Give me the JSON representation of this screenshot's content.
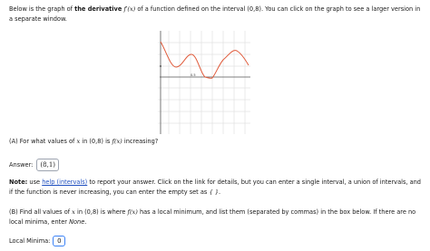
{
  "intro": {
    "p1": "Below is the graph of ",
    "bold": "the derivative",
    "fprime": "f′(x)",
    "p2": " of a function defined on the interval (0,8). You can click on the graph to see a larger version in a separate window."
  },
  "graph": {
    "axis_label": "0.5",
    "curve_color": "#e05a3a"
  },
  "question_a": {
    "p1": "(A) For what values of ",
    "x": "x",
    "p2": " in (0,8) is ",
    "fx": "f(x)",
    "p3": " increasing?"
  },
  "answer_a": {
    "label": "Answer:",
    "value": "(8,1)"
  },
  "note": {
    "bold": "Note:",
    "p1": " use ",
    "link": "help (intervals)",
    "p2": " to report your answer. Click on the link for details, but you can enter a single interval, a union of intervals, and if the function is never increasing, you can enter the empty set as ",
    "empty_set": "{ }",
    "p3": "."
  },
  "question_b": {
    "p1": "(B) Find all values of ",
    "x": "x",
    "p2": " in (0,8) is where ",
    "fx": "f(x)",
    "p3": " has a local minimum, and list them (separated by commas) in the box below. If there are no local minima, enter ",
    "none": "None",
    "p4": "."
  },
  "answer_b": {
    "label": "Local Minima:",
    "value": "0"
  }
}
